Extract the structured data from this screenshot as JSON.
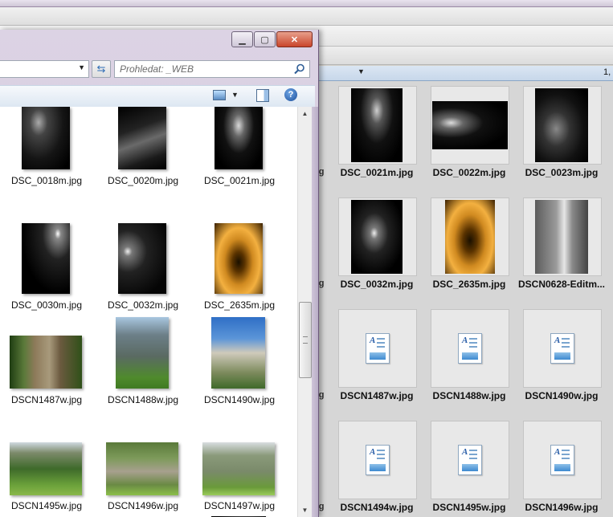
{
  "background_window": {
    "header_number": "1,",
    "thumbnails": [
      {
        "label": "DSC_0021m.jpg"
      },
      {
        "label": "DSC_0022m.jpg"
      },
      {
        "label": "DSC_0023m.jpg"
      },
      {
        "label": "DSC_0032m.jpg"
      },
      {
        "label": "DSC_2635m.jpg"
      },
      {
        "label": "DSCN0628-Editm..."
      },
      {
        "label": "DSCN1487w.jpg"
      },
      {
        "label": "DSCN1488w.jpg"
      },
      {
        "label": "DSCN1490w.jpg"
      },
      {
        "label": "DSCN1494w.jpg"
      },
      {
        "label": "DSCN1495w.jpg"
      },
      {
        "label": "DSCN1496w.jpg"
      }
    ],
    "partial_labels": [
      "pg",
      "pg",
      "pg",
      "pg"
    ]
  },
  "front_window": {
    "search": {
      "placeholder": "Prohledat: _WEB"
    },
    "files": [
      {
        "label": "DSC_0018m.jpg"
      },
      {
        "label": "DSC_0020m.jpg"
      },
      {
        "label": "DSC_0021m.jpg"
      },
      {
        "label": "DSC_0030m.jpg"
      },
      {
        "label": "DSC_0032m.jpg"
      },
      {
        "label": "DSC_2635m.jpg"
      },
      {
        "label": "DSCN1487w.jpg"
      },
      {
        "label": "DSCN1488w.jpg"
      },
      {
        "label": "DSCN1490w.jpg"
      },
      {
        "label": "DSCN1495w.jpg"
      },
      {
        "label": "DSCN1496w.jpg"
      },
      {
        "label": "DSCN1497w.jpg"
      }
    ]
  },
  "icons": {
    "minimize": "minimize-icon",
    "maximize": "maximize-icon",
    "close": "close-icon",
    "refresh": "refresh-icon",
    "search": "search-icon",
    "views": "views-icon",
    "preview_pane": "preview-pane-icon",
    "help": "help-icon",
    "document": "document-icon"
  },
  "colors": {
    "selection_highlight": "#cfe0f5",
    "close_button": "#c9452b",
    "window_frame": "#d6cde0"
  }
}
